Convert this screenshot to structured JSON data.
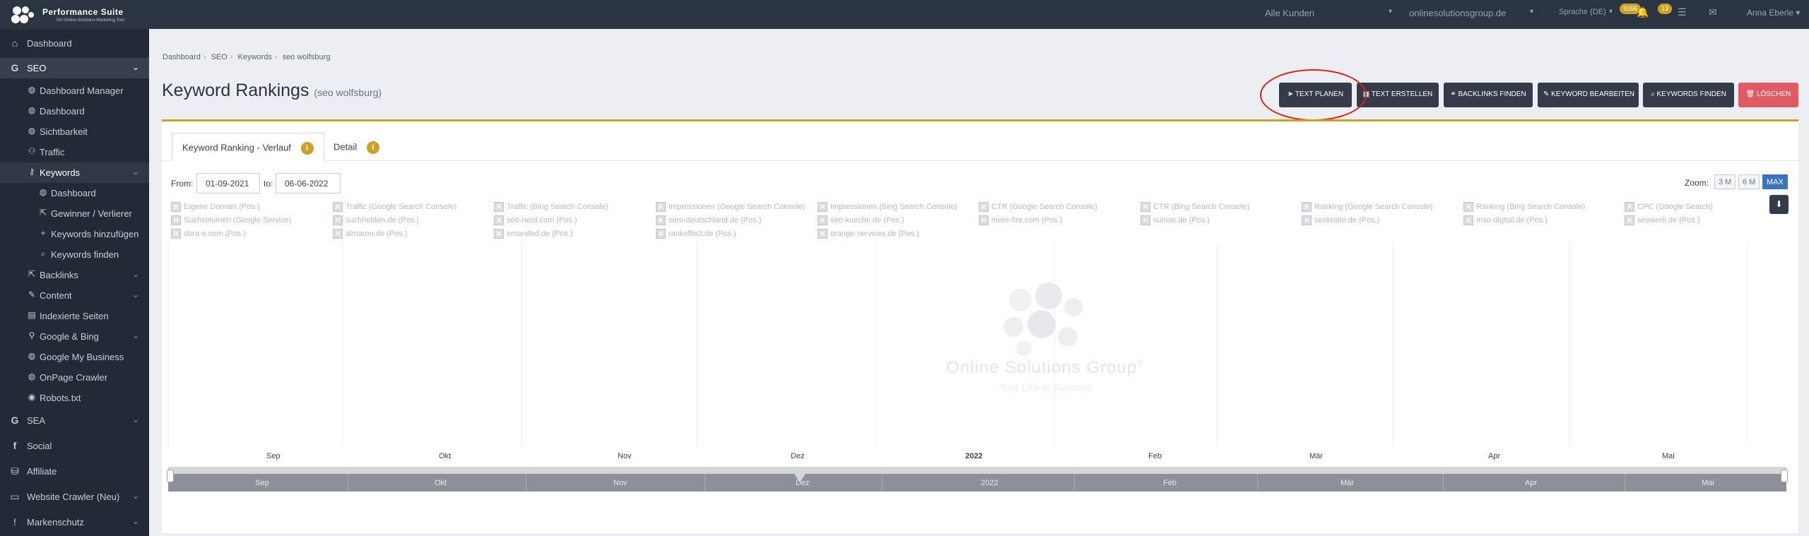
{
  "topbar": {
    "brand": "Performance Suite",
    "brand_tag": "Ein Online-Solutions-Marketing-Tool",
    "customer_select": "Alle Kunden",
    "domain_select": "onlinesolutionsgroup.de",
    "language_select": "Sprache (DE)",
    "badge_notifications": "9266",
    "badge_tasks": "13",
    "user_name": "Anna Eberle"
  },
  "sidebar": {
    "items": [
      {
        "label": "Dashboard",
        "icon": "home-icon"
      },
      {
        "label": "SEO",
        "icon": "google-icon"
      },
      {
        "label": "Dashboard Manager",
        "icon": "globe-icon"
      },
      {
        "label": "Dashboard",
        "icon": "globe-icon"
      },
      {
        "label": "Sichtbarkeit",
        "icon": "globe-icon"
      },
      {
        "label": "Traffic",
        "icon": "traffic-icon"
      },
      {
        "label": "Keywords",
        "icon": "key-icon"
      },
      {
        "label": "Dashboard",
        "icon": "globe-icon"
      },
      {
        "label": "Gewinner / Verlierer",
        "icon": "external-link-icon"
      },
      {
        "label": "Keywords hinzufügen",
        "icon": "plus-icon"
      },
      {
        "label": "Keywords finden",
        "icon": "search-icon"
      },
      {
        "label": "Backlinks",
        "icon": "external-link-icon"
      },
      {
        "label": "Content",
        "icon": "edit-icon"
      },
      {
        "label": "Indexierte Seiten",
        "icon": "page-icon"
      },
      {
        "label": "Google & Bing",
        "icon": "link-icon"
      },
      {
        "label": "Google My Business",
        "icon": "globe-icon"
      },
      {
        "label": "OnPage Crawler",
        "icon": "globe-icon"
      },
      {
        "label": "Robots.txt",
        "icon": "robot-icon"
      },
      {
        "label": "SEA",
        "icon": "google-icon"
      },
      {
        "label": "Social",
        "icon": "facebook-icon"
      },
      {
        "label": "Affiliate",
        "icon": "affiliate-icon"
      },
      {
        "label": "Website Crawler (Neu)",
        "icon": "laptop-icon"
      },
      {
        "label": "Markenschutz",
        "icon": "exclamation-icon"
      }
    ]
  },
  "breadcrumb": [
    "Dashboard",
    "SEO",
    "Keywords",
    "seo wolfsburg"
  ],
  "page": {
    "title": "Keyword Rankings",
    "subtitle": "(seo wolfsburg)"
  },
  "actions": {
    "text_planen": "TEXT PLANEN",
    "text_erstellen": "TEXT ERSTELLEN",
    "backlinks_finden": "BACKLINKS FINDEN",
    "keyword_bearbeiten": "KEYWORD BEARBEITEN",
    "keywords_finden": "KEYWORDS FINDEN",
    "loeschen": "LÖSCHEN"
  },
  "tabs": {
    "verlauf": "Keyword Ranking - Verlauf",
    "detail": "Detail",
    "info_glyph": "i"
  },
  "range": {
    "from_label": "From:",
    "from_value": "01-09-2021",
    "to_label": "to:",
    "to_value": "06-06-2022"
  },
  "zoom": {
    "label": "Zoom:",
    "options": [
      "3 M",
      "6 M",
      "MAX"
    ],
    "selected": "MAX"
  },
  "chart_data": {
    "type": "line",
    "series": [
      {
        "name": "Eigene Domain (Pos.)"
      },
      {
        "name": "Suchvolumen (Google Service)"
      },
      {
        "name": "dora-e.com (Pos.)"
      },
      {
        "name": "Traffic (Google Search Console)"
      },
      {
        "name": "suchhelden.de (Pos.)"
      },
      {
        "name": "almaron.de (Pos.)"
      },
      {
        "name": "Traffic (Bing Search Console)"
      },
      {
        "name": "seo-nerd.com (Pos.)"
      },
      {
        "name": "emanded.de (Pos.)"
      },
      {
        "name": "Impressionen (Google Search Console)"
      },
      {
        "name": "sem-deutschland.de (Pos.)"
      },
      {
        "name": "rankeffect.de (Pos.)"
      },
      {
        "name": "Impressionen (Bing Search Console)"
      },
      {
        "name": "seo-kueche.de (Pos.)"
      },
      {
        "name": "orange-services.de (Pos.)"
      },
      {
        "name": "CTR (Google Search Console)"
      },
      {
        "name": "more-fire.com (Pos.)"
      },
      {
        "name": "CTR (Bing Search Console)"
      },
      {
        "name": "sumax.de (Pos.)"
      },
      {
        "name": "Ranking (Google Search Console)"
      },
      {
        "name": "seokratie.de (Pos.)"
      },
      {
        "name": "Ranking (Bing Search Console)"
      },
      {
        "name": "mso-digital.de (Pos.)"
      },
      {
        "name": "CPC (Google Search)"
      },
      {
        "name": "seowerk.de (Pos.)"
      }
    ],
    "x_ticks": [
      "Sep",
      "Okt",
      "Nov",
      "Dez",
      "2022",
      "Feb",
      "Mär",
      "Apr",
      "Mai"
    ],
    "navigator_ticks": [
      "Sep",
      "Okt",
      "Nov",
      "Dez",
      "2022",
      "Feb",
      "Mär",
      "Apr",
      "Mai"
    ],
    "legend_position": "top"
  },
  "watermark": {
    "text": "Online Solutions Group",
    "tagline": "Your Link to Success",
    "registered": "®"
  },
  "colors": {
    "accent_gold": "#c9a227",
    "sidebar_bg": "#232a35",
    "button_dark": "#343c49",
    "delete_red": "#e05a66",
    "zoom_blue": "#3b73b9",
    "annotation_red": "#d42222"
  }
}
